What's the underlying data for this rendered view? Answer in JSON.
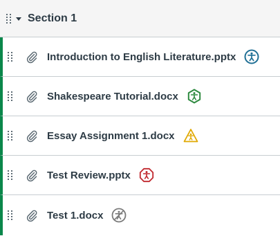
{
  "module": {
    "title": "Section 1",
    "drag_icon": "drag-handle-icon",
    "caret_icon": "caret-down-icon"
  },
  "items": [
    {
      "title": "Introduction to English Literature.pptx",
      "attachment_icon": "paperclip-icon",
      "accessibility_icon": "accessibility-circle-icon",
      "accessibility_color": "#1f6f95"
    },
    {
      "title": "Shakespeare Tutorial.docx",
      "attachment_icon": "paperclip-icon",
      "accessibility_icon": "accessibility-hexagon-icon",
      "accessibility_color": "#2e8a3f"
    },
    {
      "title": "Essay Assignment 1.docx",
      "attachment_icon": "paperclip-icon",
      "accessibility_icon": "accessibility-triangle-icon",
      "accessibility_color": "#e0a800"
    },
    {
      "title": "Test Review.pptx",
      "attachment_icon": "paperclip-icon",
      "accessibility_icon": "accessibility-octagon-icon",
      "accessibility_color": "#c0272d"
    },
    {
      "title": "Test 1.docx",
      "attachment_icon": "paperclip-icon",
      "accessibility_icon": "accessibility-unavailable-icon",
      "accessibility_color": "#7a7a7a"
    }
  ],
  "colors": {
    "published_border": "#0b874b",
    "text": "#2d3b45",
    "header_bg": "#f5f5f5"
  }
}
